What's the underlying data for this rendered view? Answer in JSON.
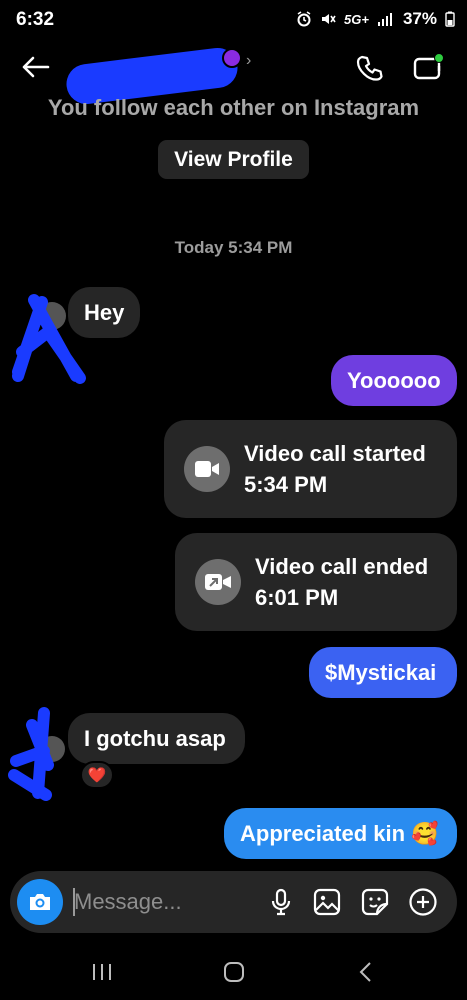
{
  "status_bar": {
    "time": "6:32",
    "network": "5G+",
    "battery": "37%"
  },
  "header": {
    "back_icon": "arrow-left-icon",
    "call_icon": "phone-icon",
    "video_icon": "video-camera-icon"
  },
  "profile": {
    "follow_text": "You follow each other on Instagram",
    "view_profile_label": "View Profile"
  },
  "conversation": {
    "timestamp": "Today 5:34 PM",
    "messages": [
      {
        "sender": "them",
        "text": "Hey"
      },
      {
        "sender": "me",
        "text": "Yoooooo"
      },
      {
        "sender": "me",
        "type": "call",
        "line1": "Video call started",
        "line2": "5:34 PM"
      },
      {
        "sender": "me",
        "type": "call",
        "line1": "Video call ended",
        "line2": "6:01 PM"
      },
      {
        "sender": "me",
        "text": "$Mystickai"
      },
      {
        "sender": "them",
        "text": "I gotchu asap",
        "reaction": "❤️"
      },
      {
        "sender": "me",
        "text": "Appreciated kin 🥰"
      }
    ]
  },
  "composer": {
    "placeholder": "Message...",
    "icons": [
      "camera-icon",
      "microphone-icon",
      "gallery-icon",
      "sticker-icon",
      "plus-icon"
    ]
  },
  "colors": {
    "background": "#000000",
    "incoming_bubble": "#262626",
    "purple_bubble": "#6f3ee0",
    "blue_bubble": "#3b62f2",
    "light_blue_bubble": "#2a8cf0",
    "camera_button": "#1d8df2",
    "redaction": "#1a3bff"
  }
}
